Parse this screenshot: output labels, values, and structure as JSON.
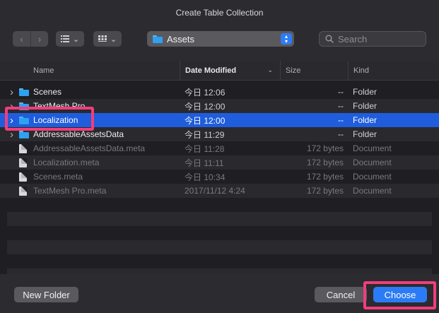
{
  "window": {
    "title": "Create Table Collection"
  },
  "toolbar": {
    "back_icon": "chevron-left-icon",
    "forward_icon": "chevron-right-icon",
    "list_view_icon": "list-icon",
    "grid_view_icon": "grid-icon",
    "location": "Assets",
    "search_placeholder": "Search"
  },
  "columns": {
    "name": "Name",
    "date": "Date Modified",
    "size": "Size",
    "kind": "Kind"
  },
  "rows": [
    {
      "name": "Scenes",
      "date": "今日 12:06",
      "size": "--",
      "kind": "Folder",
      "type": "folder"
    },
    {
      "name": "TextMesh Pro",
      "date": "今日 12:00",
      "size": "--",
      "kind": "Folder",
      "type": "folder"
    },
    {
      "name": "Localization",
      "date": "今日 12:00",
      "size": "--",
      "kind": "Folder",
      "type": "folder",
      "selected": true
    },
    {
      "name": "AddressableAssetsData",
      "date": "今日 11:29",
      "size": "--",
      "kind": "Folder",
      "type": "folder"
    },
    {
      "name": "AddressableAssetsData.meta",
      "date": "今日 11:28",
      "size": "172 bytes",
      "kind": "Document",
      "type": "doc"
    },
    {
      "name": "Localization.meta",
      "date": "今日 11:11",
      "size": "172 bytes",
      "kind": "Document",
      "type": "doc"
    },
    {
      "name": "Scenes.meta",
      "date": "今日 10:34",
      "size": "172 bytes",
      "kind": "Document",
      "type": "doc"
    },
    {
      "name": "TextMesh Pro.meta",
      "date": "2017/11/12 4:24",
      "size": "172 bytes",
      "kind": "Document",
      "type": "doc"
    }
  ],
  "footer": {
    "new_folder": "New Folder",
    "cancel": "Cancel",
    "choose": "Choose"
  },
  "colors": {
    "accent": "#2c7bf6",
    "selection": "#1f5ddc",
    "highlight": "#f23d7a",
    "folder": "#2ea1ef"
  }
}
